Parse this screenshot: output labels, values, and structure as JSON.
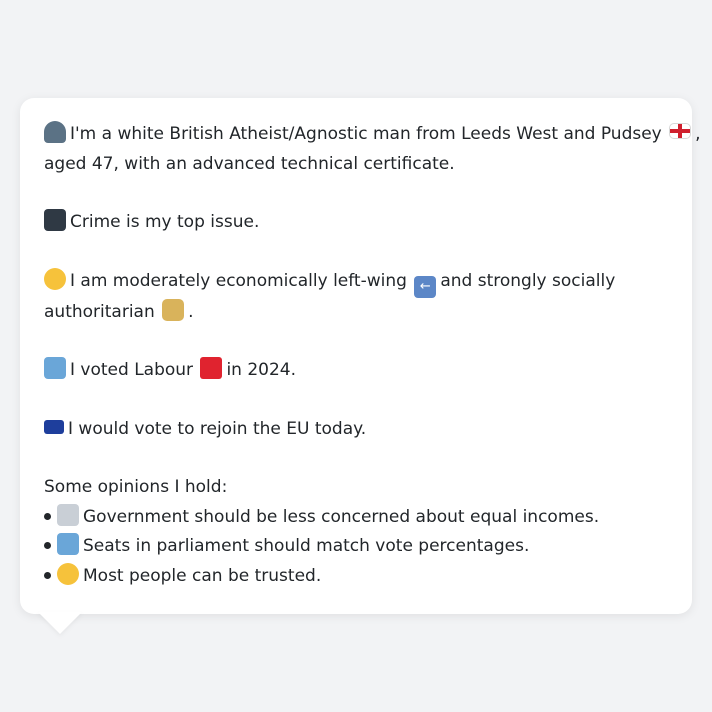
{
  "card": {
    "intro_line1": "I'm a white British Atheist/Agnostic man from Leeds West and Pudsey",
    "intro_line1_end": ",",
    "intro_line2": "aged 47, with an advanced technical certificate.",
    "top_issue": "Crime is my top issue.",
    "ideology_line1_a": "I am moderately economically left-wing",
    "ideology_line1_b": "and strongly socially",
    "ideology_line2_a": "authoritarian",
    "ideology_line2_b": ".",
    "vote_a": "I voted Labour",
    "vote_b": "in 2024.",
    "eu": "I would vote to rejoin the EU today.",
    "opinions_heading": "Some opinions I hold:",
    "opinions": [
      "Government should be less concerned about equal incomes.",
      "Seats in parliament should match vote percentages.",
      "Most people can be trusted."
    ]
  },
  "icons": {
    "person": "bust-in-silhouette-icon",
    "england_flag": "england-flag-icon",
    "police_car": "police-car-icon",
    "thinking": "thinking-face-icon",
    "left_arrow": "left-arrow-icon",
    "lock": "lock-icon",
    "ballot": "ballot-box-icon",
    "red_square": "red-square-icon",
    "eu_flag": "eu-flag-icon",
    "judge": "judge-icon",
    "smile": "smiling-face-icon"
  },
  "colors": {
    "background": "#f2f3f5",
    "card": "#ffffff",
    "text": "#22262a",
    "labour_red": "#e0232f"
  }
}
